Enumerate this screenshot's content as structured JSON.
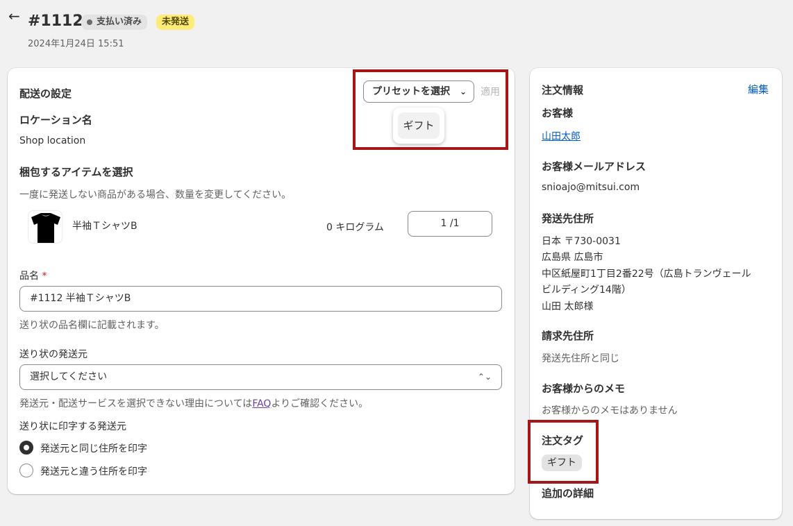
{
  "header": {
    "order_number": "#1112",
    "payment_status": "支払い済み",
    "fulfillment_status": "未発送",
    "date": "2024年1月24日 15:51"
  },
  "shipping": {
    "title": "配送の設定",
    "preset_select_label": "プリセットを選択",
    "apply_label": "適用",
    "preset_options": [
      "ギフト"
    ],
    "location_heading": "ロケーション名",
    "location_value": "Shop location",
    "items_heading": "梱包するアイテムを選択",
    "items_help": "一度に発送しない商品がある場合、数量を変更してください。",
    "item": {
      "name": "半袖ＴシャツB",
      "weight": "0 キログラム",
      "quantity": "1 /1"
    },
    "product_name_label": "品名",
    "required_mark": "*",
    "product_name_value": "#1112 半袖ＴシャツB",
    "product_name_help": "送り状の品名欄に記載されます。",
    "sender_label": "送り状の発送元",
    "sender_placeholder": "選択してください",
    "sender_help_before": "発送元・配送サービスを選択できない理由については",
    "sender_help_link": "FAQ",
    "sender_help_after": "よりご確認ください。",
    "print_sender_label": "送り状に印字する発送元",
    "print_options": [
      {
        "label": "発送元と同じ住所を印字",
        "checked": true
      },
      {
        "label": "発送元と違う住所を印字",
        "checked": false
      }
    ]
  },
  "order_info": {
    "title": "注文情報",
    "edit_label": "編集",
    "customer_heading": "お客様",
    "customer_name": "山田太郎",
    "email_heading": "お客様メールアドレス",
    "email": "snioajo@mitsui.com",
    "shipping_address_heading": "発送先住所",
    "shipping_address_lines": [
      "日本 〒730-0031",
      "広島県 広島市",
      "中区紙屋町1丁目2番22号（広島トランヴェール",
      "ビルディング14階）",
      "山田 太郎様"
    ],
    "billing_heading": "請求先住所",
    "billing_value": "発送先住所と同じ",
    "memo_heading": "お客様からのメモ",
    "memo_value": "お客様からのメモはありません",
    "tags_heading": "注文タグ",
    "tags": [
      "ギフト"
    ],
    "additional_heading": "追加の詳細"
  },
  "colors": {
    "highlight": "#a61616",
    "link": "#005bd3",
    "unshipped_badge": "#ffeb78",
    "paid_badge": "#e3e3e3"
  },
  "icons": {
    "back": "arrow-left-icon",
    "chevron": "chevron-down-icon",
    "select_arrows": "select-updown-icon",
    "product": "tshirt-icon"
  }
}
